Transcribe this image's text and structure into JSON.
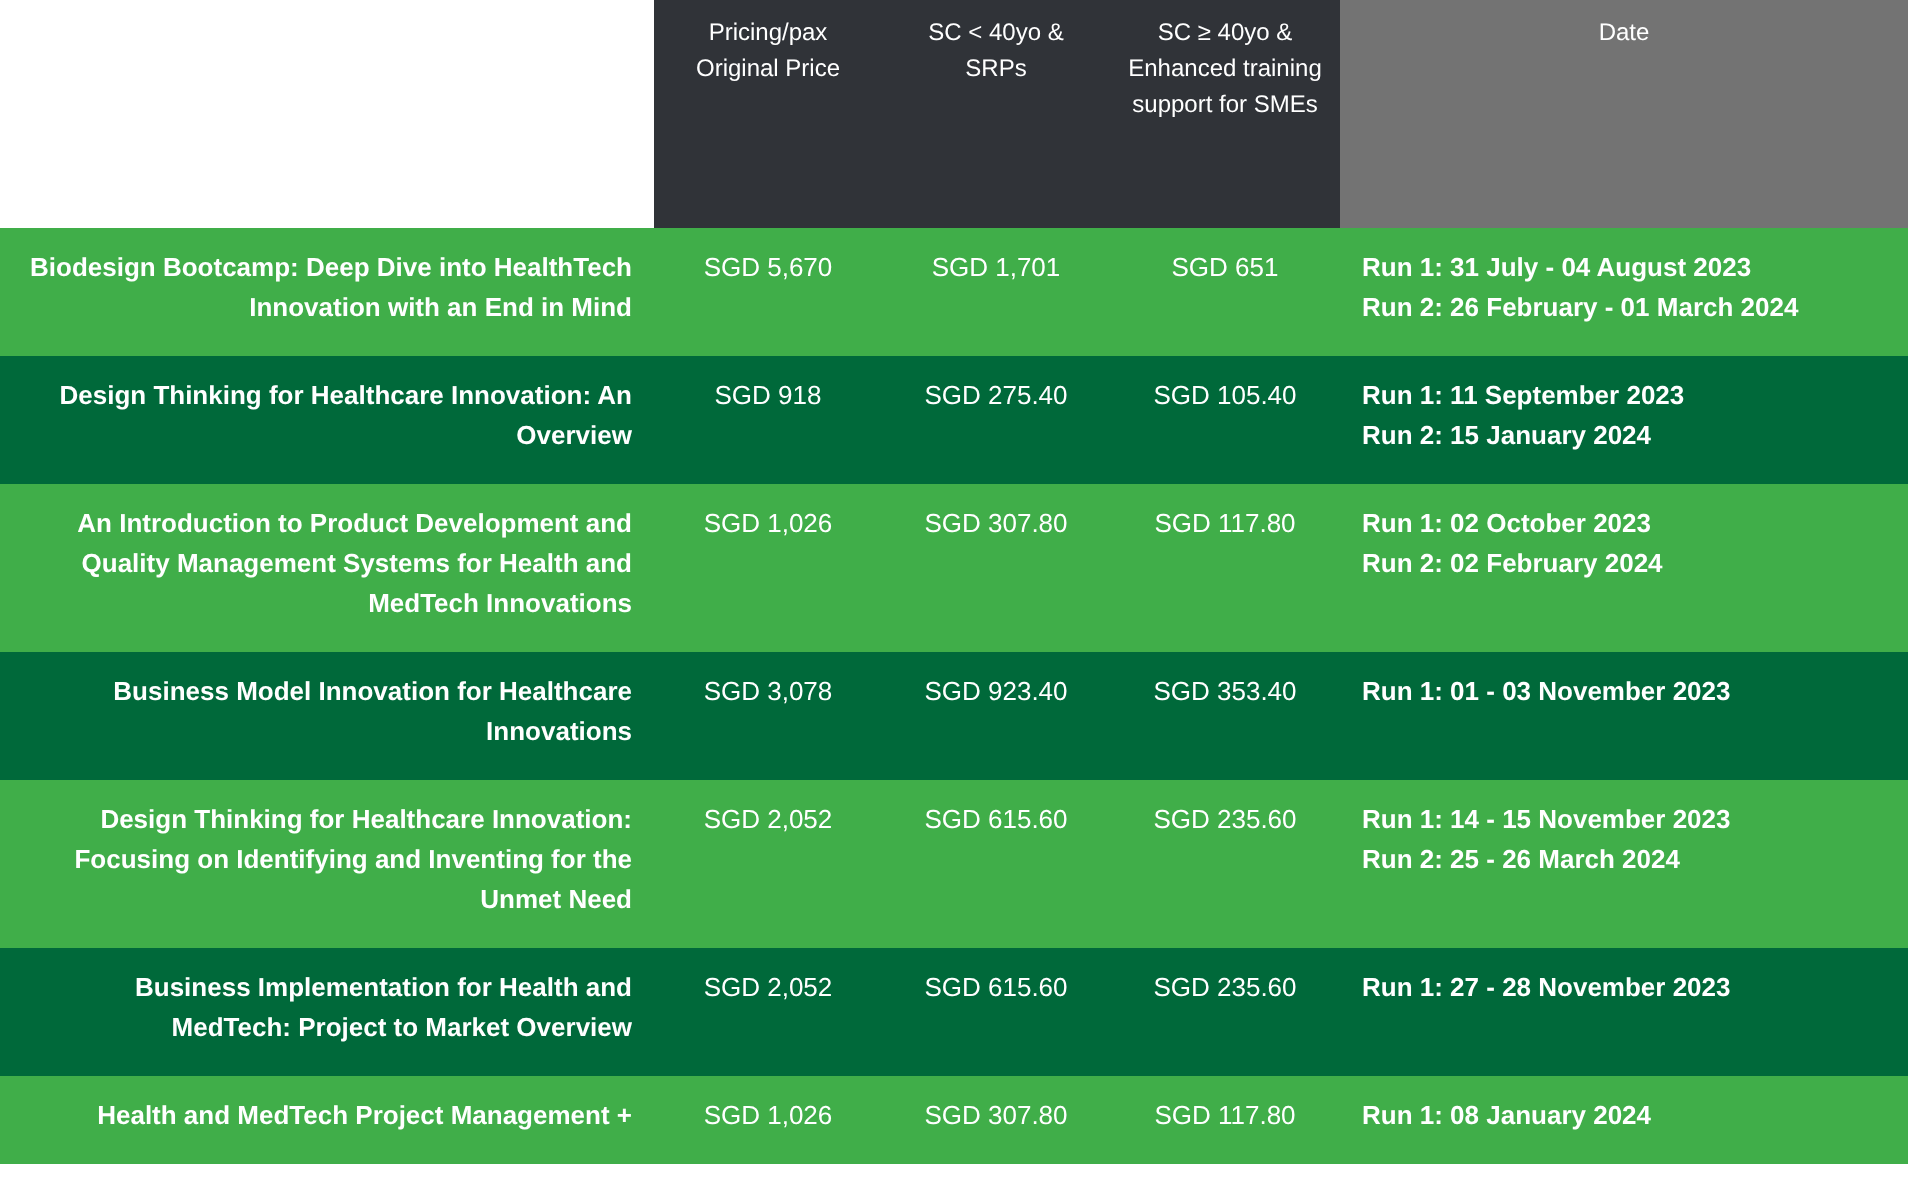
{
  "table": {
    "columns": [
      "Pricing/pax Original Price",
      "SC < 40yo & SRPs",
      "SC ≥ 40yo & Enhanced training support for SMEs",
      "Date"
    ],
    "rows": [
      {
        "course": "Biodesign Bootcamp: Deep Dive into HealthTech Innovation with an End in Mind",
        "original": "SGD 5,670",
        "sc_under_40": "SGD 1,701",
        "sc_40_plus": "SGD 651",
        "runs": [
          "Run 1: 31 July - 04 August 2023",
          "Run 2: 26 February - 01 March 2024"
        ]
      },
      {
        "course": "Design Thinking for Healthcare Innovation: An Overview",
        "original": "SGD 918",
        "sc_under_40": "SGD 275.40",
        "sc_40_plus": "SGD 105.40",
        "runs": [
          "Run 1: 11 September 2023",
          "Run 2: 15 January 2024"
        ]
      },
      {
        "course": "An Introduction to Product Development and Quality Management Systems for Health and MedTech Innovations",
        "original": "SGD 1,026",
        "sc_under_40": "SGD 307.80",
        "sc_40_plus": "SGD 117.80",
        "runs": [
          "Run 1: 02 October 2023",
          "Run 2: 02 February 2024"
        ]
      },
      {
        "course": "Business Model Innovation for Healthcare Innovations",
        "original": "SGD 3,078",
        "sc_under_40": "SGD 923.40",
        "sc_40_plus": "SGD 353.40",
        "runs": [
          "Run 1: 01 - 03 November 2023"
        ]
      },
      {
        "course": "Design Thinking for Healthcare Innovation: Focusing on Identifying and Inventing for the Unmet Need",
        "original": "SGD 2,052",
        "sc_under_40": "SGD 615.60",
        "sc_40_plus": "SGD 235.60",
        "runs": [
          "Run 1: 14 - 15 November 2023",
          "Run 2: 25 - 26 March 2024"
        ]
      },
      {
        "course": "Business Implementation for Health and MedTech: Project to Market Overview",
        "original": "SGD 2,052",
        "sc_under_40": "SGD 615.60",
        "sc_40_plus": "SGD 235.60",
        "runs": [
          "Run 1: 27 - 28 November 2023"
        ]
      },
      {
        "course": "Health and MedTech Project Management +",
        "original": "SGD 1,026",
        "sc_under_40": "SGD 307.80",
        "sc_40_plus": "SGD 117.80",
        "runs": [
          "Run 1: 08 January 2024"
        ]
      }
    ]
  }
}
